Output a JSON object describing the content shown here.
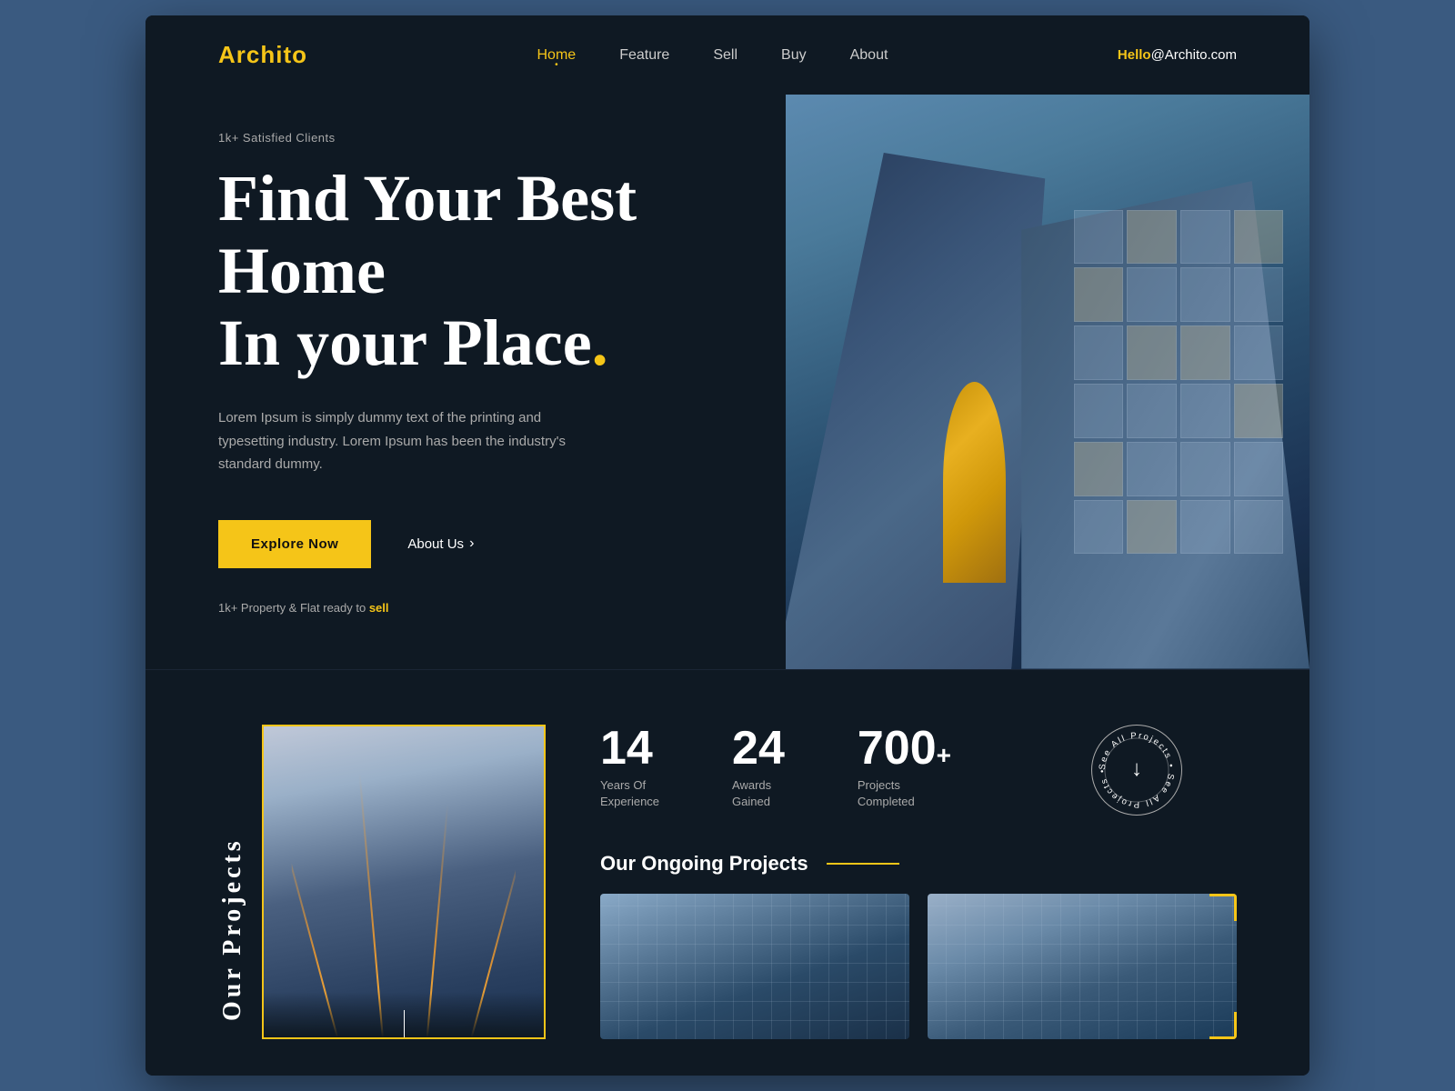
{
  "brand": {
    "logo_prefix": "Archi",
    "logo_highlight": "to",
    "email_highlight": "Hello",
    "email_rest": "@Archito.com"
  },
  "nav": {
    "links": [
      {
        "label": "Home",
        "active": true
      },
      {
        "label": "Feature",
        "active": false
      },
      {
        "label": "Sell",
        "active": false
      },
      {
        "label": "Buy",
        "active": false
      },
      {
        "label": "About",
        "active": false
      }
    ]
  },
  "hero": {
    "tagline": "1k+ Satisfied Clients",
    "title_line1": "Find Your Best Home",
    "title_line2": "In your Place",
    "title_dot": ".",
    "description": "Lorem Ipsum is simply dummy text of the printing and typesetting industry. Lorem Ipsum has been the industry's standard dummy.",
    "btn_explore": "Explore Now",
    "btn_about": "About Us",
    "footnote_prefix": "1k+ Property & Flat ready to ",
    "footnote_link": "sell"
  },
  "stats": {
    "items": [
      {
        "number": "14",
        "plus": "",
        "label_line1": "Years Of",
        "label_line2": "Experience"
      },
      {
        "number": "24",
        "plus": "",
        "label_line1": "Awards",
        "label_line2": "Gained"
      },
      {
        "number": "700",
        "plus": "+",
        "label_line1": "Projects",
        "label_line2": "Completed"
      }
    ],
    "see_all_text": "See All Projects • See All Projects • "
  },
  "projects": {
    "sidebar_label": "Our Projects",
    "ongoing_title": "Our Ongoing Projects"
  },
  "colors": {
    "accent": "#f5c518",
    "bg_dark": "#0f1923",
    "text_light": "#ffffff",
    "text_muted": "#aaaaaa",
    "outer_bg": "#3a5a80"
  }
}
